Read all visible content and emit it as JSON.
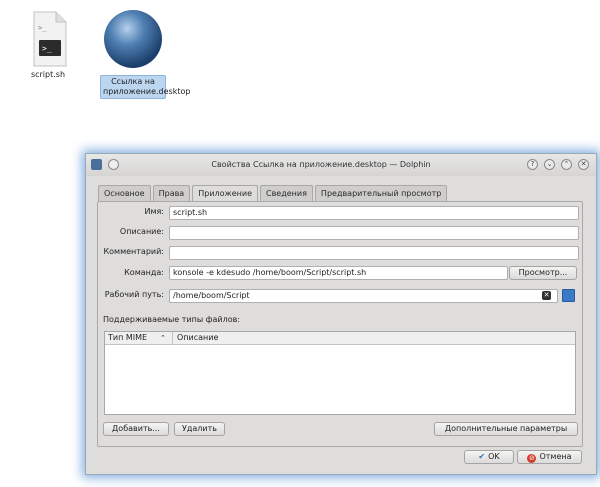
{
  "desktop": {
    "script_label": "script.sh",
    "link_label": "Ссылка на приложение.desktop"
  },
  "dialog": {
    "title": "Свойства Ссылка на приложение.desktop — Dolphin",
    "tabs": [
      {
        "label": "Основное"
      },
      {
        "label": "Права"
      },
      {
        "label": "Приложение"
      },
      {
        "label": "Сведения"
      },
      {
        "label": "Предварительный просмотр"
      }
    ],
    "active_tab": "Приложение",
    "fields": {
      "name_label": "Имя:",
      "name_value": "script.sh",
      "description_label": "Описание:",
      "description_value": "",
      "comment_label": "Комментарий:",
      "comment_value": "",
      "command_label": "Команда:",
      "command_value": "konsole -e kdesudo  /home/boom/Script/script.sh",
      "browse_label": "Просмотр...",
      "workdir_label": "Рабочий путь:",
      "workdir_value": "/home/boom/Script"
    },
    "mime": {
      "section_label": "Поддерживаемые типы файлов:",
      "col_type": "Тип MIME",
      "col_description": "Описание"
    },
    "buttons": {
      "add": "Добавить...",
      "remove": "Удалить",
      "advanced": "Дополнительные параметры",
      "ok": "OK",
      "cancel": "Отмена"
    }
  },
  "colors": {
    "focus_glow": "#5f96d7",
    "selection": "#bcd6f0"
  }
}
